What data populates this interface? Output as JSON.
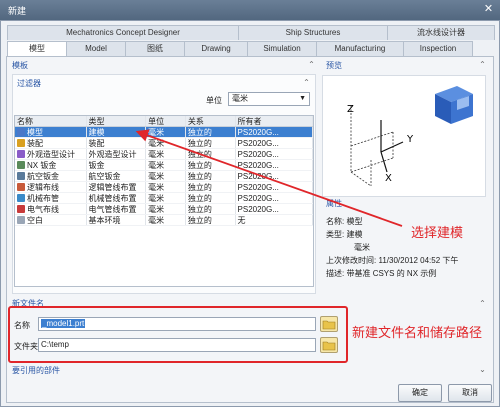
{
  "window": {
    "title": "新建",
    "close": "✕"
  },
  "top_tabs": [
    "Mechatronics Concept Designer",
    "Ship Structures",
    "流水线设计器"
  ],
  "tabs": [
    "模型",
    "Model",
    "图纸",
    "Drawing",
    "Simulation",
    "Manufacturing",
    "Inspection"
  ],
  "active_tab": "模型",
  "template_section": "模板",
  "filter_section": "过滤器",
  "unit": {
    "label": "单位",
    "value": "毫米"
  },
  "grid": {
    "headers": [
      "名称",
      "类型",
      "单位",
      "关系",
      "所有者"
    ],
    "rows": [
      {
        "name": "模型",
        "type": "建模",
        "unit": "毫米",
        "rel": "独立的",
        "owner": "PS2020G...",
        "icon_color": "#4a78c8"
      },
      {
        "name": "装配",
        "type": "装配",
        "unit": "毫米",
        "rel": "独立的",
        "owner": "PS2020G...",
        "icon_color": "#d9a020"
      },
      {
        "name": "外观造型设计",
        "type": "外观造型设计",
        "unit": "毫米",
        "rel": "独立的",
        "owner": "PS2020G...",
        "icon_color": "#8a5cc8"
      },
      {
        "name": "NX 钣金",
        "type": "钣金",
        "unit": "毫米",
        "rel": "独立的",
        "owner": "PS2020G...",
        "icon_color": "#5a8a5a"
      },
      {
        "name": "航空钣金",
        "type": "航空钣金",
        "unit": "毫米",
        "rel": "独立的",
        "owner": "PS2020G...",
        "icon_color": "#5a7a9a"
      },
      {
        "name": "逻辑布线",
        "type": "逻辑管线布置",
        "unit": "毫米",
        "rel": "独立的",
        "owner": "PS2020G...",
        "icon_color": "#c85a3a"
      },
      {
        "name": "机械布管",
        "type": "机械管线布置",
        "unit": "毫米",
        "rel": "独立的",
        "owner": "PS2020G...",
        "icon_color": "#3a8ac8"
      },
      {
        "name": "电气布线",
        "type": "电气管线布置",
        "unit": "毫米",
        "rel": "独立的",
        "owner": "PS2020G...",
        "icon_color": "#c83a3a"
      },
      {
        "name": "空白",
        "type": "基本环境",
        "unit": "毫米",
        "rel": "独立的",
        "owner": "无",
        "icon_color": "#9aa6b6"
      }
    ]
  },
  "preview": {
    "title": "预览",
    "axes": {
      "z": "Z",
      "y": "Y",
      "x": "X"
    }
  },
  "properties": {
    "title": "属性",
    "name_label": "名称:",
    "name_value": "模型",
    "type_label": "类型:",
    "type_value": "建模",
    "unit_value": "毫米",
    "modified_label": "上次修改时间:",
    "modified_value": "11/30/2012 04:52 下午",
    "desc_label": "描述:",
    "desc_value": "带基准 CSYS 的 NX 示例"
  },
  "new_file": {
    "section": "新文件名",
    "name_label": "名称",
    "name_value": "_model1.prt",
    "folder_label": "文件夹",
    "folder_value": "C:\\temp"
  },
  "ref_section": "要引用的部件",
  "annotations": {
    "select": "选择建模",
    "file": "新建文件名和储存路径"
  },
  "buttons": {
    "ok": "确定",
    "cancel": "取消"
  },
  "colors": {
    "annotation": "#e0262a",
    "selection": "#3c7fd0",
    "section_title": "#2a56a5"
  }
}
